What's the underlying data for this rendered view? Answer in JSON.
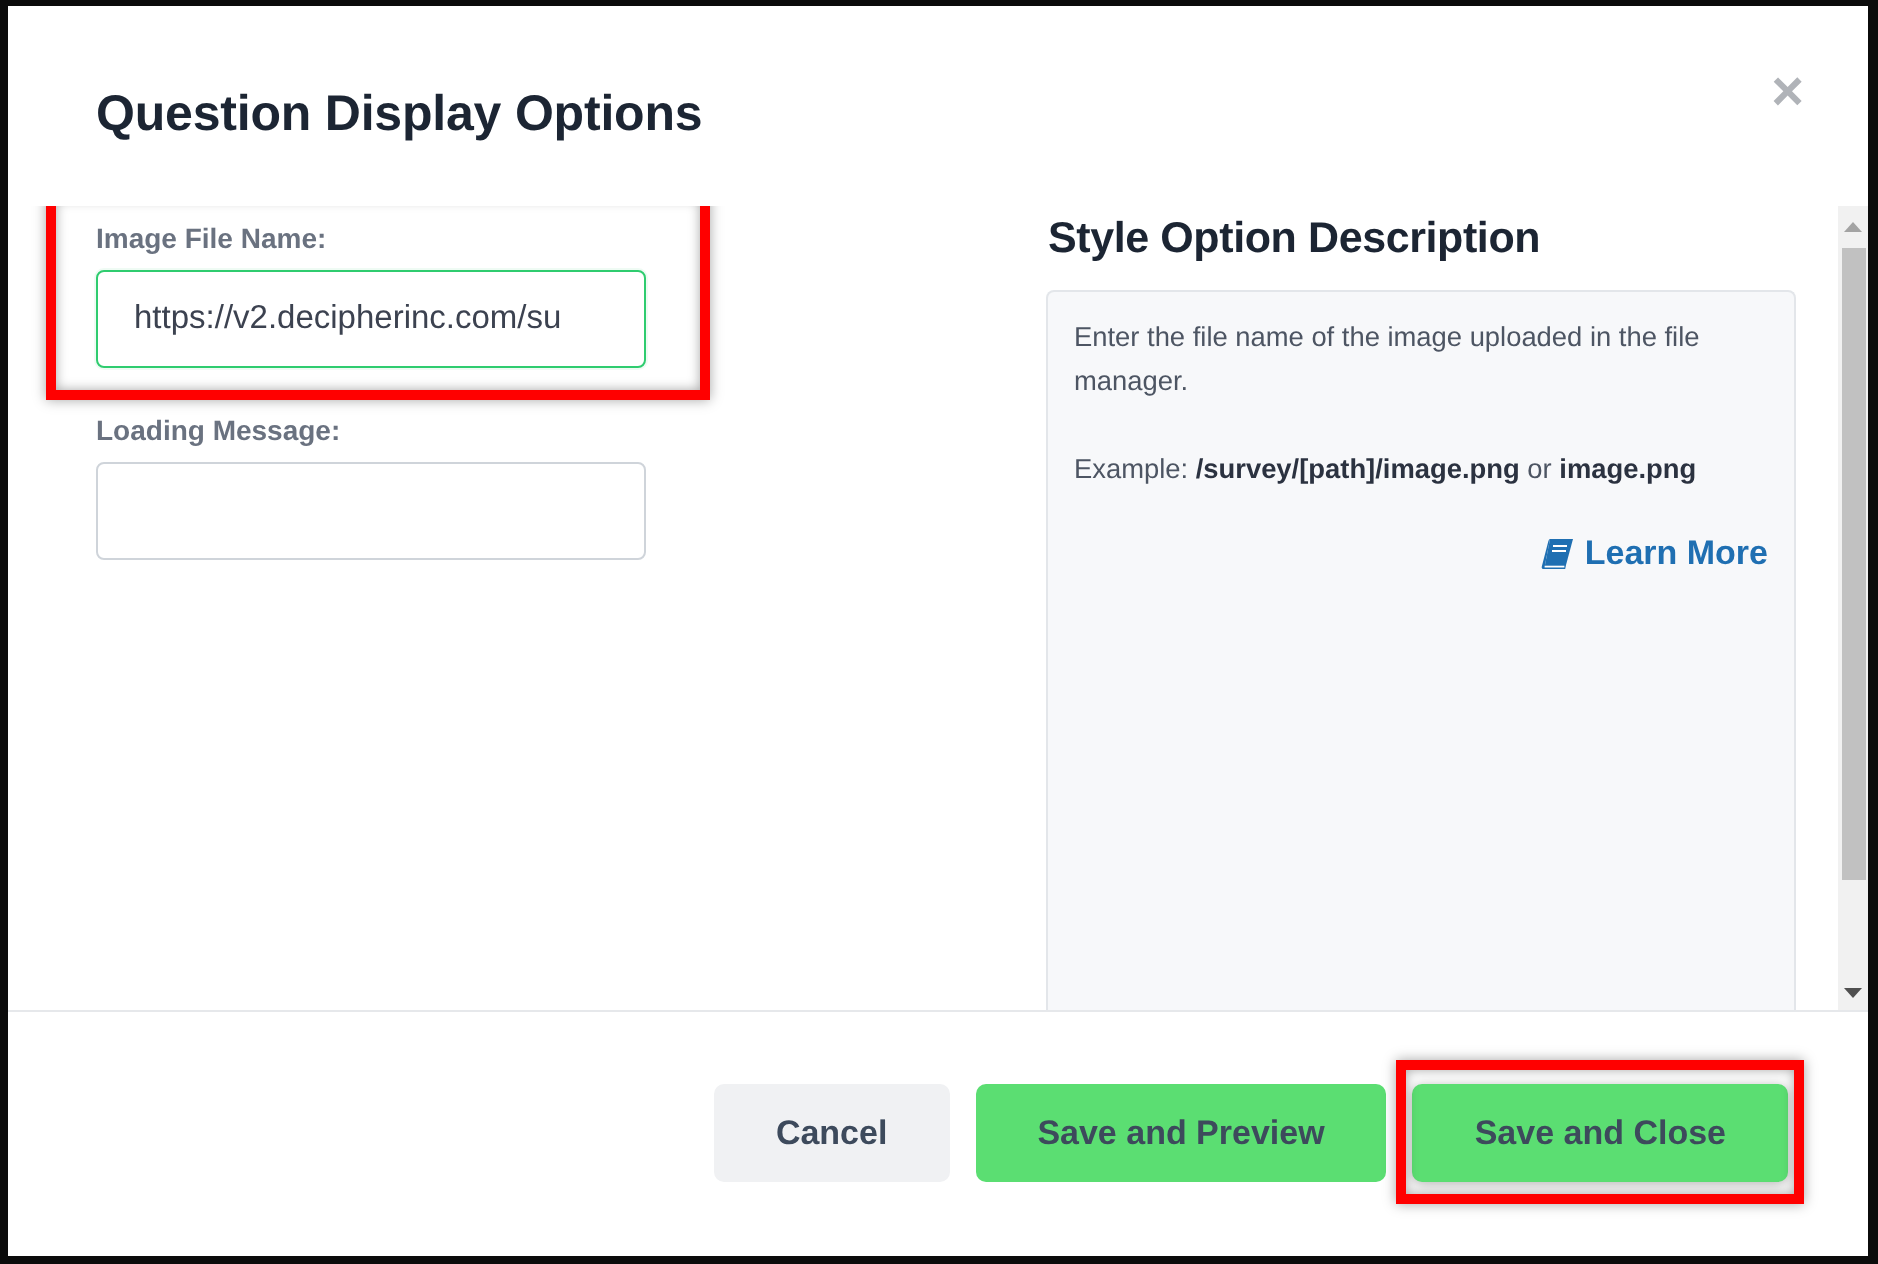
{
  "dialog": {
    "title": "Question Display Options",
    "close": "×"
  },
  "fields": [
    {
      "label": "Image File Name:",
      "value": "https://v2.decipherinc.com/su",
      "focused": true,
      "highlighted": true
    },
    {
      "label": "Loading Message:",
      "focused": false,
      "highlighted": false
    }
  ],
  "description": {
    "title": "Style Option Description",
    "paragraphs": [
      "Enter the file name of the image uploaded in the file manager.",
      "Example: **/survey/[path]/image.png** or **image.png**"
    ],
    "link": "Learn More"
  },
  "buttons": [
    {
      "label": "Cancel",
      "kind": "secondary",
      "highlighted": false
    },
    {
      "label": "Save and Preview",
      "kind": "primary",
      "highlighted": false
    },
    {
      "label": "Save and Close",
      "kind": "primary",
      "highlighted": true
    }
  ]
}
